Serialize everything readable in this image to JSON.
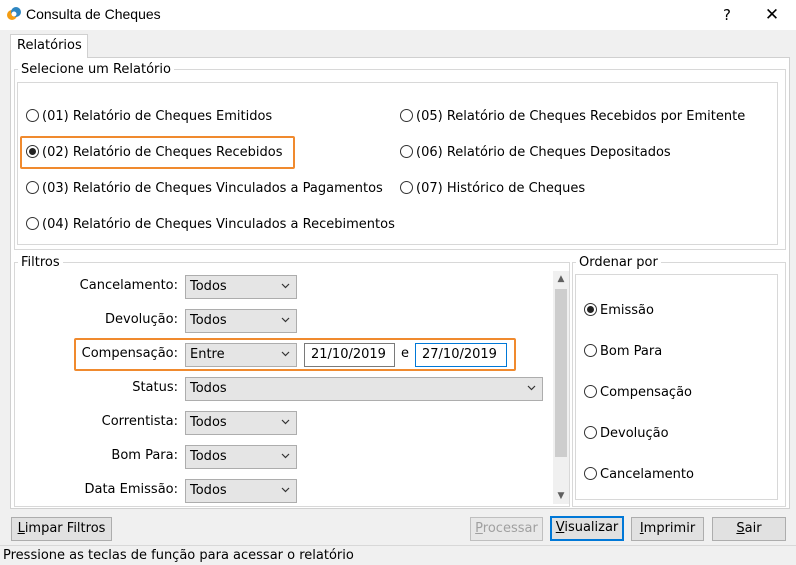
{
  "window": {
    "title": "Consulta de Cheques",
    "help_glyph": "?",
    "close_glyph": "✕"
  },
  "tabs": [
    {
      "label": "Relatórios"
    }
  ],
  "reports": {
    "legend": "Selecione um Relatório",
    "options": [
      {
        "label": "(01) Relatório de Cheques Emitidos",
        "selected": false
      },
      {
        "label": "(02) Relatório de Cheques Recebidos",
        "selected": true
      },
      {
        "label": "(03) Relatório de Cheques Vinculados a Pagamentos",
        "selected": false
      },
      {
        "label": "(04) Relatório de Cheques Vinculados a Recebimentos",
        "selected": false
      },
      {
        "label": "(05) Relatório de Cheques Recebidos por Emitente",
        "selected": false
      },
      {
        "label": "(06) Relatório de Cheques Depositados",
        "selected": false
      },
      {
        "label": "(07) Histórico de Cheques",
        "selected": false
      }
    ]
  },
  "filters": {
    "legend": "Filtros",
    "cancelamento": {
      "label": "Cancelamento:",
      "value": "Todos"
    },
    "devolucao": {
      "label": "Devolução:",
      "value": "Todos"
    },
    "compensacao": {
      "label": "Compensação:",
      "value": "Entre",
      "date_from": "21/10/2019",
      "connector": "e",
      "date_to": "27/10/2019"
    },
    "status": {
      "label": "Status:",
      "value": "Todos"
    },
    "correntista": {
      "label": "Correntista:",
      "value": "Todos"
    },
    "bom_para": {
      "label": "Bom Para:",
      "value": "Todos"
    },
    "data_emissao": {
      "label": "Data Emissão:",
      "value": "Todos"
    }
  },
  "order": {
    "legend": "Ordenar por",
    "options": [
      {
        "label": "Emissão",
        "selected": true
      },
      {
        "label": "Bom Para",
        "selected": false
      },
      {
        "label": "Compensação",
        "selected": false
      },
      {
        "label": "Devolução",
        "selected": false
      },
      {
        "label": "Cancelamento",
        "selected": false
      }
    ]
  },
  "buttons": {
    "limpar_prefix": "L",
    "limpar_rest": "impar Filtros",
    "processar_prefix": "P",
    "processar_rest": "rocessar",
    "visualizar_prefix": "V",
    "visualizar_rest": "isualizar",
    "imprimir_prefix": "I",
    "imprimir_rest": "mprimir",
    "sair_prefix": "S",
    "sair_rest": "air"
  },
  "status_bar": {
    "text": "Pressione as teclas de função para acessar o relatório"
  },
  "colors": {
    "highlight": "#f08a2e",
    "focus": "#0078d7"
  }
}
